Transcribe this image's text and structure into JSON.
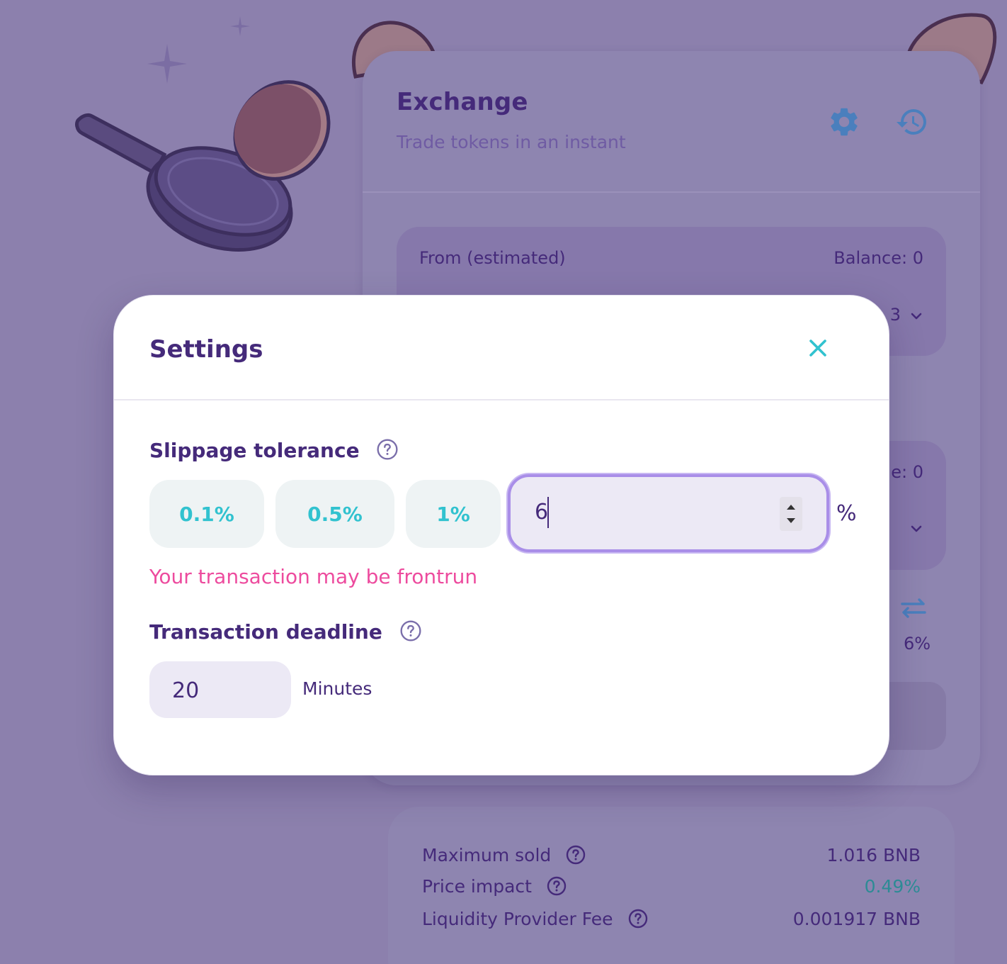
{
  "exchange": {
    "title": "Exchange",
    "subtitle": "Trade tokens in an instant",
    "from_label": "From (estimated)",
    "from_balance": "Balance: 0",
    "from_token_fragment": "3",
    "to_balance_fragment": "e: 0",
    "price_slippage": "6%"
  },
  "details": {
    "rows": [
      {
        "label": "Maximum sold",
        "value": "1.016 BNB",
        "value_color": "#452a7a"
      },
      {
        "label": "Price impact",
        "value": "0.49%",
        "value_color": "#31c2cf"
      },
      {
        "label": "Liquidity Provider Fee",
        "value": "0.001917 BNB",
        "value_color": "#452a7a"
      }
    ]
  },
  "settings": {
    "title": "Settings",
    "slippage_label": "Slippage tolerance",
    "presets": [
      "0.1%",
      "0.5%",
      "1%"
    ],
    "slippage_value": "6",
    "percent_sign": "%",
    "warning": "Your transaction may be frontrun",
    "deadline_label": "Transaction deadline",
    "deadline_value": "20",
    "deadline_unit": "Minutes"
  },
  "colors": {
    "background": "#8c80ad",
    "primary_text": "#452a7a",
    "accent": "#31c2cf",
    "warning": "#ed4b9e",
    "input_focus": "#a98ee8"
  }
}
